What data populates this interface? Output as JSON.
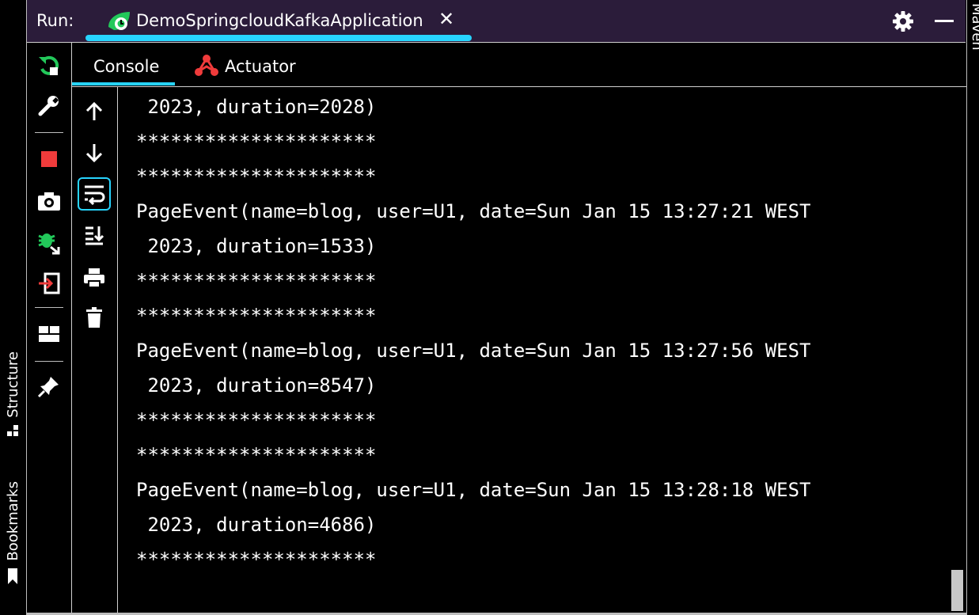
{
  "left_stripe": {
    "structure": "Structure",
    "bookmarks": "Bookmarks"
  },
  "right_stripe": {
    "label": "Maven"
  },
  "header": {
    "run_label": "Run:",
    "tab_title": "DemoSpringcloudKafkaApplication",
    "close_glyph": "✕"
  },
  "tabs": [
    {
      "label": "Console"
    },
    {
      "label": "Actuator"
    }
  ],
  "console": {
    "lines": [
      " 2023, duration=2028)",
      "*********************",
      "*********************",
      "PageEvent(name=blog, user=U1, date=Sun Jan 15 13:27:21 WEST",
      " 2023, duration=1533)",
      "*********************",
      "*********************",
      "PageEvent(name=blog, user=U1, date=Sun Jan 15 13:27:56 WEST",
      " 2023, duration=8547)",
      "*********************",
      "*********************",
      "PageEvent(name=blog, user=U1, date=Sun Jan 15 13:28:18 WEST",
      " 2023, duration=4686)",
      "*********************"
    ]
  },
  "colors": {
    "header_bg": "#2b1c3a",
    "accent": "#27d4ff",
    "run_green": "#22c85a",
    "stop_red": "#f03b3b"
  }
}
